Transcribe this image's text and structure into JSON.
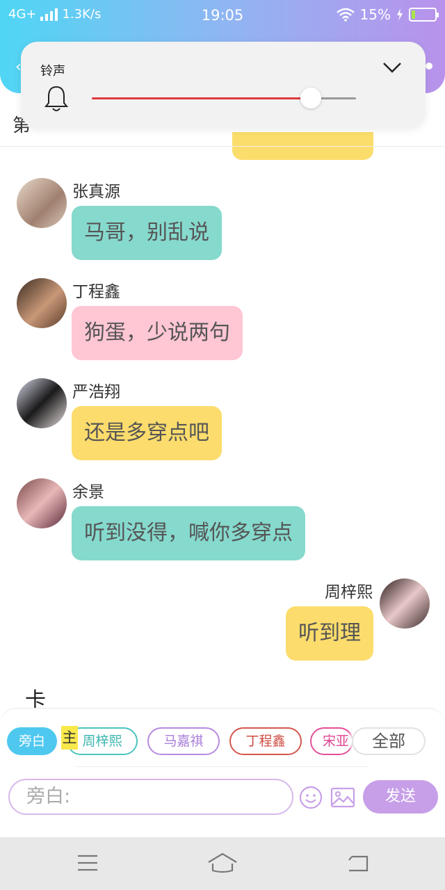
{
  "status_bar": {
    "network": "4G+",
    "speed": "1.3K/s",
    "time": "19:05",
    "battery": "15%"
  },
  "background_title": "第",
  "volume_popup": {
    "label": "铃声",
    "level": 0.83,
    "icons": [
      "bell-icon",
      "chevron-down-icon"
    ],
    "fill_color": "#e0393e"
  },
  "messages": [
    {
      "name": "张真源",
      "text": "马哥，别乱说",
      "color": "teal",
      "side": "left"
    },
    {
      "name": "丁程鑫",
      "text": "狗蛋，少说两句",
      "color": "pink",
      "side": "left"
    },
    {
      "name": "严浩翔",
      "text": "还是多穿点吧",
      "color": "yellow",
      "side": "left"
    },
    {
      "name": "余景",
      "text": "听到没得，喊你多穿点",
      "color": "teal",
      "side": "left"
    },
    {
      "name": "周梓熙",
      "text": "听到理",
      "color": "yellow",
      "side": "right"
    }
  ],
  "stray_text": "卡",
  "role_chips": {
    "narration": "旁白",
    "main_tag": "主",
    "roles": [
      "周梓熙",
      "马嘉祺",
      "丁程鑫",
      "宋亚"
    ],
    "all": "全部"
  },
  "input": {
    "placeholder": "旁白:",
    "send_label": "发送"
  },
  "colors": {
    "header_start": "#4fd6f4",
    "header_end": "#b992ec",
    "teal": "#86d9cd",
    "pink": "#ffc6d4",
    "yellow": "#fcdc6c",
    "send": "#c79fe8"
  }
}
